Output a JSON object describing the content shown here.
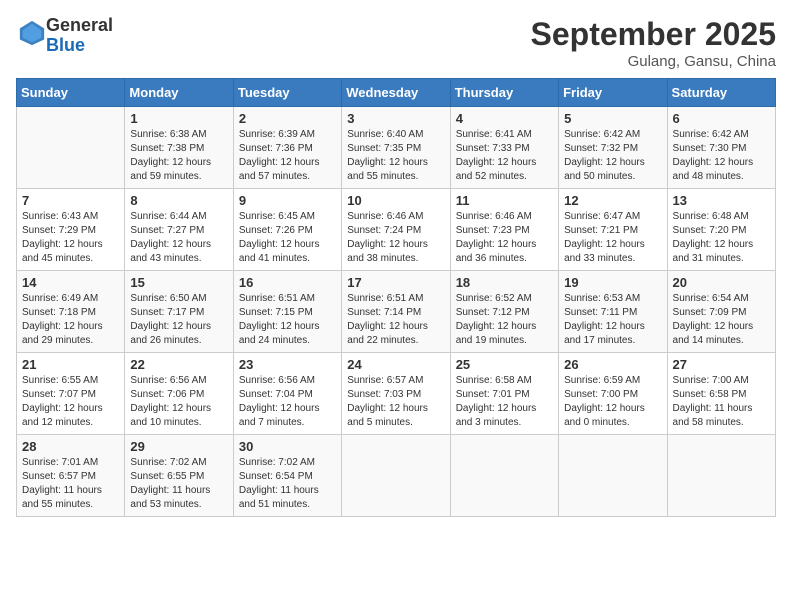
{
  "header": {
    "logo_line1": "General",
    "logo_line2": "Blue",
    "month_title": "September 2025",
    "location": "Gulang, Gansu, China"
  },
  "days_of_week": [
    "Sunday",
    "Monday",
    "Tuesday",
    "Wednesday",
    "Thursday",
    "Friday",
    "Saturday"
  ],
  "weeks": [
    [
      {
        "day": "",
        "info": ""
      },
      {
        "day": "1",
        "info": "Sunrise: 6:38 AM\nSunset: 7:38 PM\nDaylight: 12 hours\nand 59 minutes."
      },
      {
        "day": "2",
        "info": "Sunrise: 6:39 AM\nSunset: 7:36 PM\nDaylight: 12 hours\nand 57 minutes."
      },
      {
        "day": "3",
        "info": "Sunrise: 6:40 AM\nSunset: 7:35 PM\nDaylight: 12 hours\nand 55 minutes."
      },
      {
        "day": "4",
        "info": "Sunrise: 6:41 AM\nSunset: 7:33 PM\nDaylight: 12 hours\nand 52 minutes."
      },
      {
        "day": "5",
        "info": "Sunrise: 6:42 AM\nSunset: 7:32 PM\nDaylight: 12 hours\nand 50 minutes."
      },
      {
        "day": "6",
        "info": "Sunrise: 6:42 AM\nSunset: 7:30 PM\nDaylight: 12 hours\nand 48 minutes."
      }
    ],
    [
      {
        "day": "7",
        "info": "Sunrise: 6:43 AM\nSunset: 7:29 PM\nDaylight: 12 hours\nand 45 minutes."
      },
      {
        "day": "8",
        "info": "Sunrise: 6:44 AM\nSunset: 7:27 PM\nDaylight: 12 hours\nand 43 minutes."
      },
      {
        "day": "9",
        "info": "Sunrise: 6:45 AM\nSunset: 7:26 PM\nDaylight: 12 hours\nand 41 minutes."
      },
      {
        "day": "10",
        "info": "Sunrise: 6:46 AM\nSunset: 7:24 PM\nDaylight: 12 hours\nand 38 minutes."
      },
      {
        "day": "11",
        "info": "Sunrise: 6:46 AM\nSunset: 7:23 PM\nDaylight: 12 hours\nand 36 minutes."
      },
      {
        "day": "12",
        "info": "Sunrise: 6:47 AM\nSunset: 7:21 PM\nDaylight: 12 hours\nand 33 minutes."
      },
      {
        "day": "13",
        "info": "Sunrise: 6:48 AM\nSunset: 7:20 PM\nDaylight: 12 hours\nand 31 minutes."
      }
    ],
    [
      {
        "day": "14",
        "info": "Sunrise: 6:49 AM\nSunset: 7:18 PM\nDaylight: 12 hours\nand 29 minutes."
      },
      {
        "day": "15",
        "info": "Sunrise: 6:50 AM\nSunset: 7:17 PM\nDaylight: 12 hours\nand 26 minutes."
      },
      {
        "day": "16",
        "info": "Sunrise: 6:51 AM\nSunset: 7:15 PM\nDaylight: 12 hours\nand 24 minutes."
      },
      {
        "day": "17",
        "info": "Sunrise: 6:51 AM\nSunset: 7:14 PM\nDaylight: 12 hours\nand 22 minutes."
      },
      {
        "day": "18",
        "info": "Sunrise: 6:52 AM\nSunset: 7:12 PM\nDaylight: 12 hours\nand 19 minutes."
      },
      {
        "day": "19",
        "info": "Sunrise: 6:53 AM\nSunset: 7:11 PM\nDaylight: 12 hours\nand 17 minutes."
      },
      {
        "day": "20",
        "info": "Sunrise: 6:54 AM\nSunset: 7:09 PM\nDaylight: 12 hours\nand 14 minutes."
      }
    ],
    [
      {
        "day": "21",
        "info": "Sunrise: 6:55 AM\nSunset: 7:07 PM\nDaylight: 12 hours\nand 12 minutes."
      },
      {
        "day": "22",
        "info": "Sunrise: 6:56 AM\nSunset: 7:06 PM\nDaylight: 12 hours\nand 10 minutes."
      },
      {
        "day": "23",
        "info": "Sunrise: 6:56 AM\nSunset: 7:04 PM\nDaylight: 12 hours\nand 7 minutes."
      },
      {
        "day": "24",
        "info": "Sunrise: 6:57 AM\nSunset: 7:03 PM\nDaylight: 12 hours\nand 5 minutes."
      },
      {
        "day": "25",
        "info": "Sunrise: 6:58 AM\nSunset: 7:01 PM\nDaylight: 12 hours\nand 3 minutes."
      },
      {
        "day": "26",
        "info": "Sunrise: 6:59 AM\nSunset: 7:00 PM\nDaylight: 12 hours\nand 0 minutes."
      },
      {
        "day": "27",
        "info": "Sunrise: 7:00 AM\nSunset: 6:58 PM\nDaylight: 11 hours\nand 58 minutes."
      }
    ],
    [
      {
        "day": "28",
        "info": "Sunrise: 7:01 AM\nSunset: 6:57 PM\nDaylight: 11 hours\nand 55 minutes."
      },
      {
        "day": "29",
        "info": "Sunrise: 7:02 AM\nSunset: 6:55 PM\nDaylight: 11 hours\nand 53 minutes."
      },
      {
        "day": "30",
        "info": "Sunrise: 7:02 AM\nSunset: 6:54 PM\nDaylight: 11 hours\nand 51 minutes."
      },
      {
        "day": "",
        "info": ""
      },
      {
        "day": "",
        "info": ""
      },
      {
        "day": "",
        "info": ""
      },
      {
        "day": "",
        "info": ""
      }
    ]
  ]
}
